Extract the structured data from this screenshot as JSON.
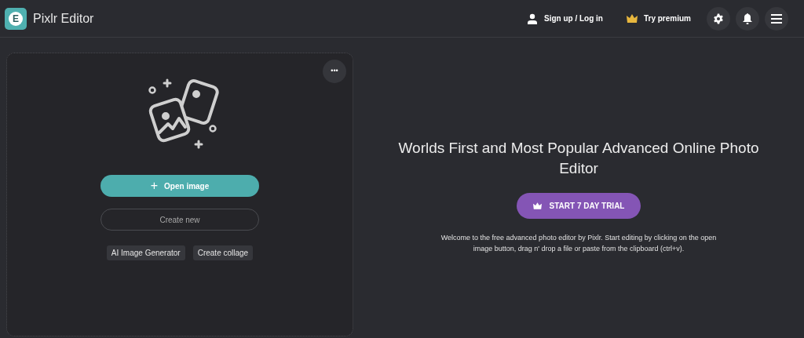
{
  "header": {
    "logo_letter": "E",
    "title": "Pixlr Editor",
    "links": [
      {
        "kind": "user",
        "label": "Sign up / Log in"
      },
      {
        "kind": "crown",
        "label": "Try premium"
      }
    ],
    "icon_buttons": [
      {
        "kind": "settings"
      },
      {
        "kind": "bell"
      },
      {
        "kind": "menu"
      }
    ]
  },
  "start_panel": {
    "more_label": "•••",
    "open_button": {
      "icon": "+",
      "label": "Open image"
    },
    "create_button": "Create new",
    "chips": [
      "AI Image Generator",
      "Create collage"
    ]
  },
  "promo": {
    "heading": "Worlds First and Most Popular Advanced Online Photo Editor",
    "trial_button": "START 7 DAY TRIAL",
    "description": "Welcome to the free advanced photo editor by Pixlr. Start editing by clicking on the open image button, drag n' drop a file or paste from the clipboard (ctrl+v)."
  }
}
